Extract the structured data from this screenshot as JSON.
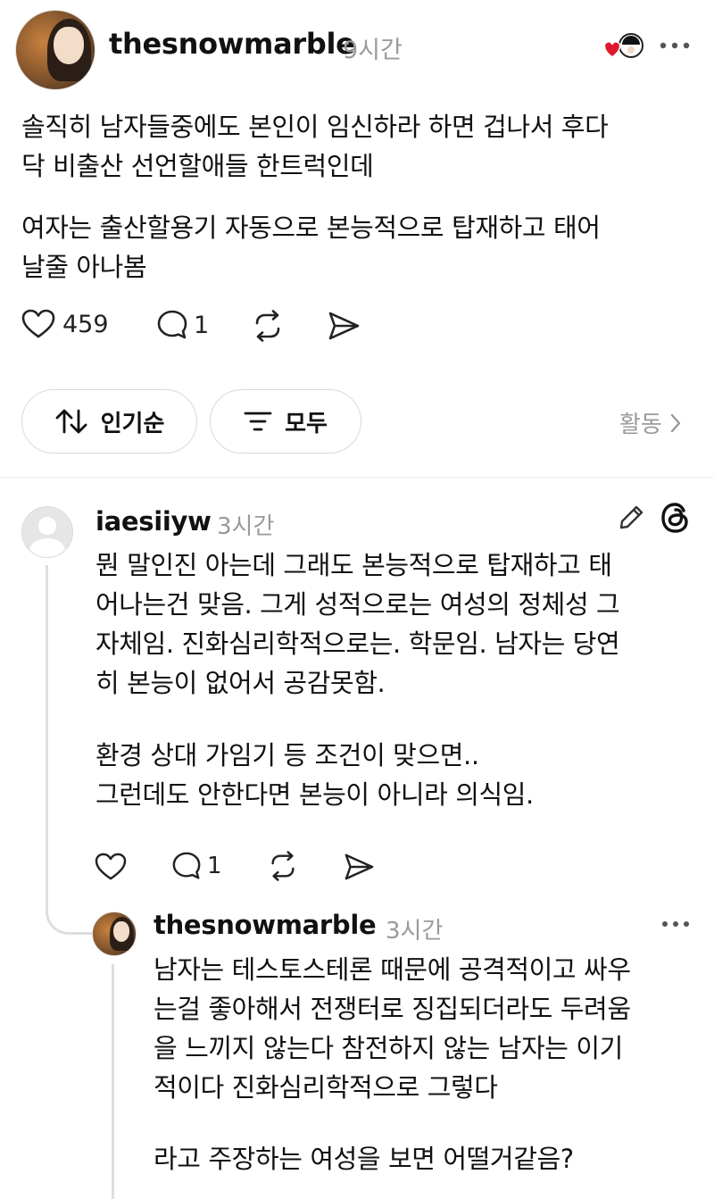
{
  "post": {
    "username": "thesnowmarble",
    "time": "9시간",
    "lines_p1": [
      "솔직히 남자들중에도 본인이 임신하라 하면 겁나서 후다",
      "닥 비출산 선언할애들 한트럭인데"
    ],
    "lines_p2": [
      "여자는 출산할용기 자동으로 본능적으로 탑재하고 태어",
      "날줄 아나봄"
    ],
    "likes": "459",
    "replies": "1"
  },
  "filters": {
    "sort_label": "인기순",
    "filter_label": "모두",
    "activity_label": "활동"
  },
  "comment": {
    "username": "iaesiiyw",
    "time": "3시간",
    "lines_p1": [
      "뭔 말인진 아는데 그래도 본능적으로 탑재하고 태",
      "어나는건 맞음. 그게 성적으로는 여성의 정체성 그",
      "자체임. 진화심리학적으로는. 학문임. 남자는 당연",
      "히 본능이 없어서 공감못함."
    ],
    "lines_p2": [
      "환경 상대 가임기 등 조건이 맞으면..",
      "그런데도 안한다면 본능이 아니라 의식임."
    ],
    "replies": "1"
  },
  "reply": {
    "username": "thesnowmarble",
    "time": "3시간",
    "lines_p1": [
      "남자는 테스토스테론 때문에 공격적이고 싸우",
      "는걸 좋아해서 전쟁터로 징집되더라도 두려움",
      "을 느끼지 않는다 참전하지 않는 남자는 이기",
      "적이다 진화심리학적으로 그렇다"
    ],
    "lines_p2": [
      "라고 주장하는 여성을 보면 어떨거같음?"
    ]
  }
}
